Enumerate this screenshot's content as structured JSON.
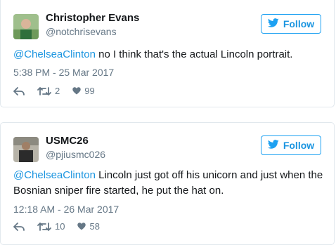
{
  "colors": {
    "link": "#1b95e0",
    "muted": "#657786",
    "border": "#e1e8ed",
    "text": "#14171a"
  },
  "tweets": [
    {
      "name": "Christopher Evans",
      "handle": "@notchrisevans",
      "follow_label": "Follow",
      "mention": "@ChelseaClinton",
      "text": " no I think that's the actual Lincoln portrait.",
      "timestamp": "5:38 PM - 25 Mar 2017",
      "retweets": "2",
      "likes": "99",
      "avatar_icon": "avatar-photo"
    },
    {
      "name": "USMC26",
      "handle": "@pjiusmc026",
      "follow_label": "Follow",
      "mention": "@ChelseaClinton",
      "text": " Lincoln just got off his unicorn and just when the Bosnian sniper fire started, he put the hat on.",
      "timestamp": "12:18 AM - 26 Mar 2017",
      "retweets": "10",
      "likes": "58",
      "avatar_icon": "avatar-photo"
    }
  ]
}
